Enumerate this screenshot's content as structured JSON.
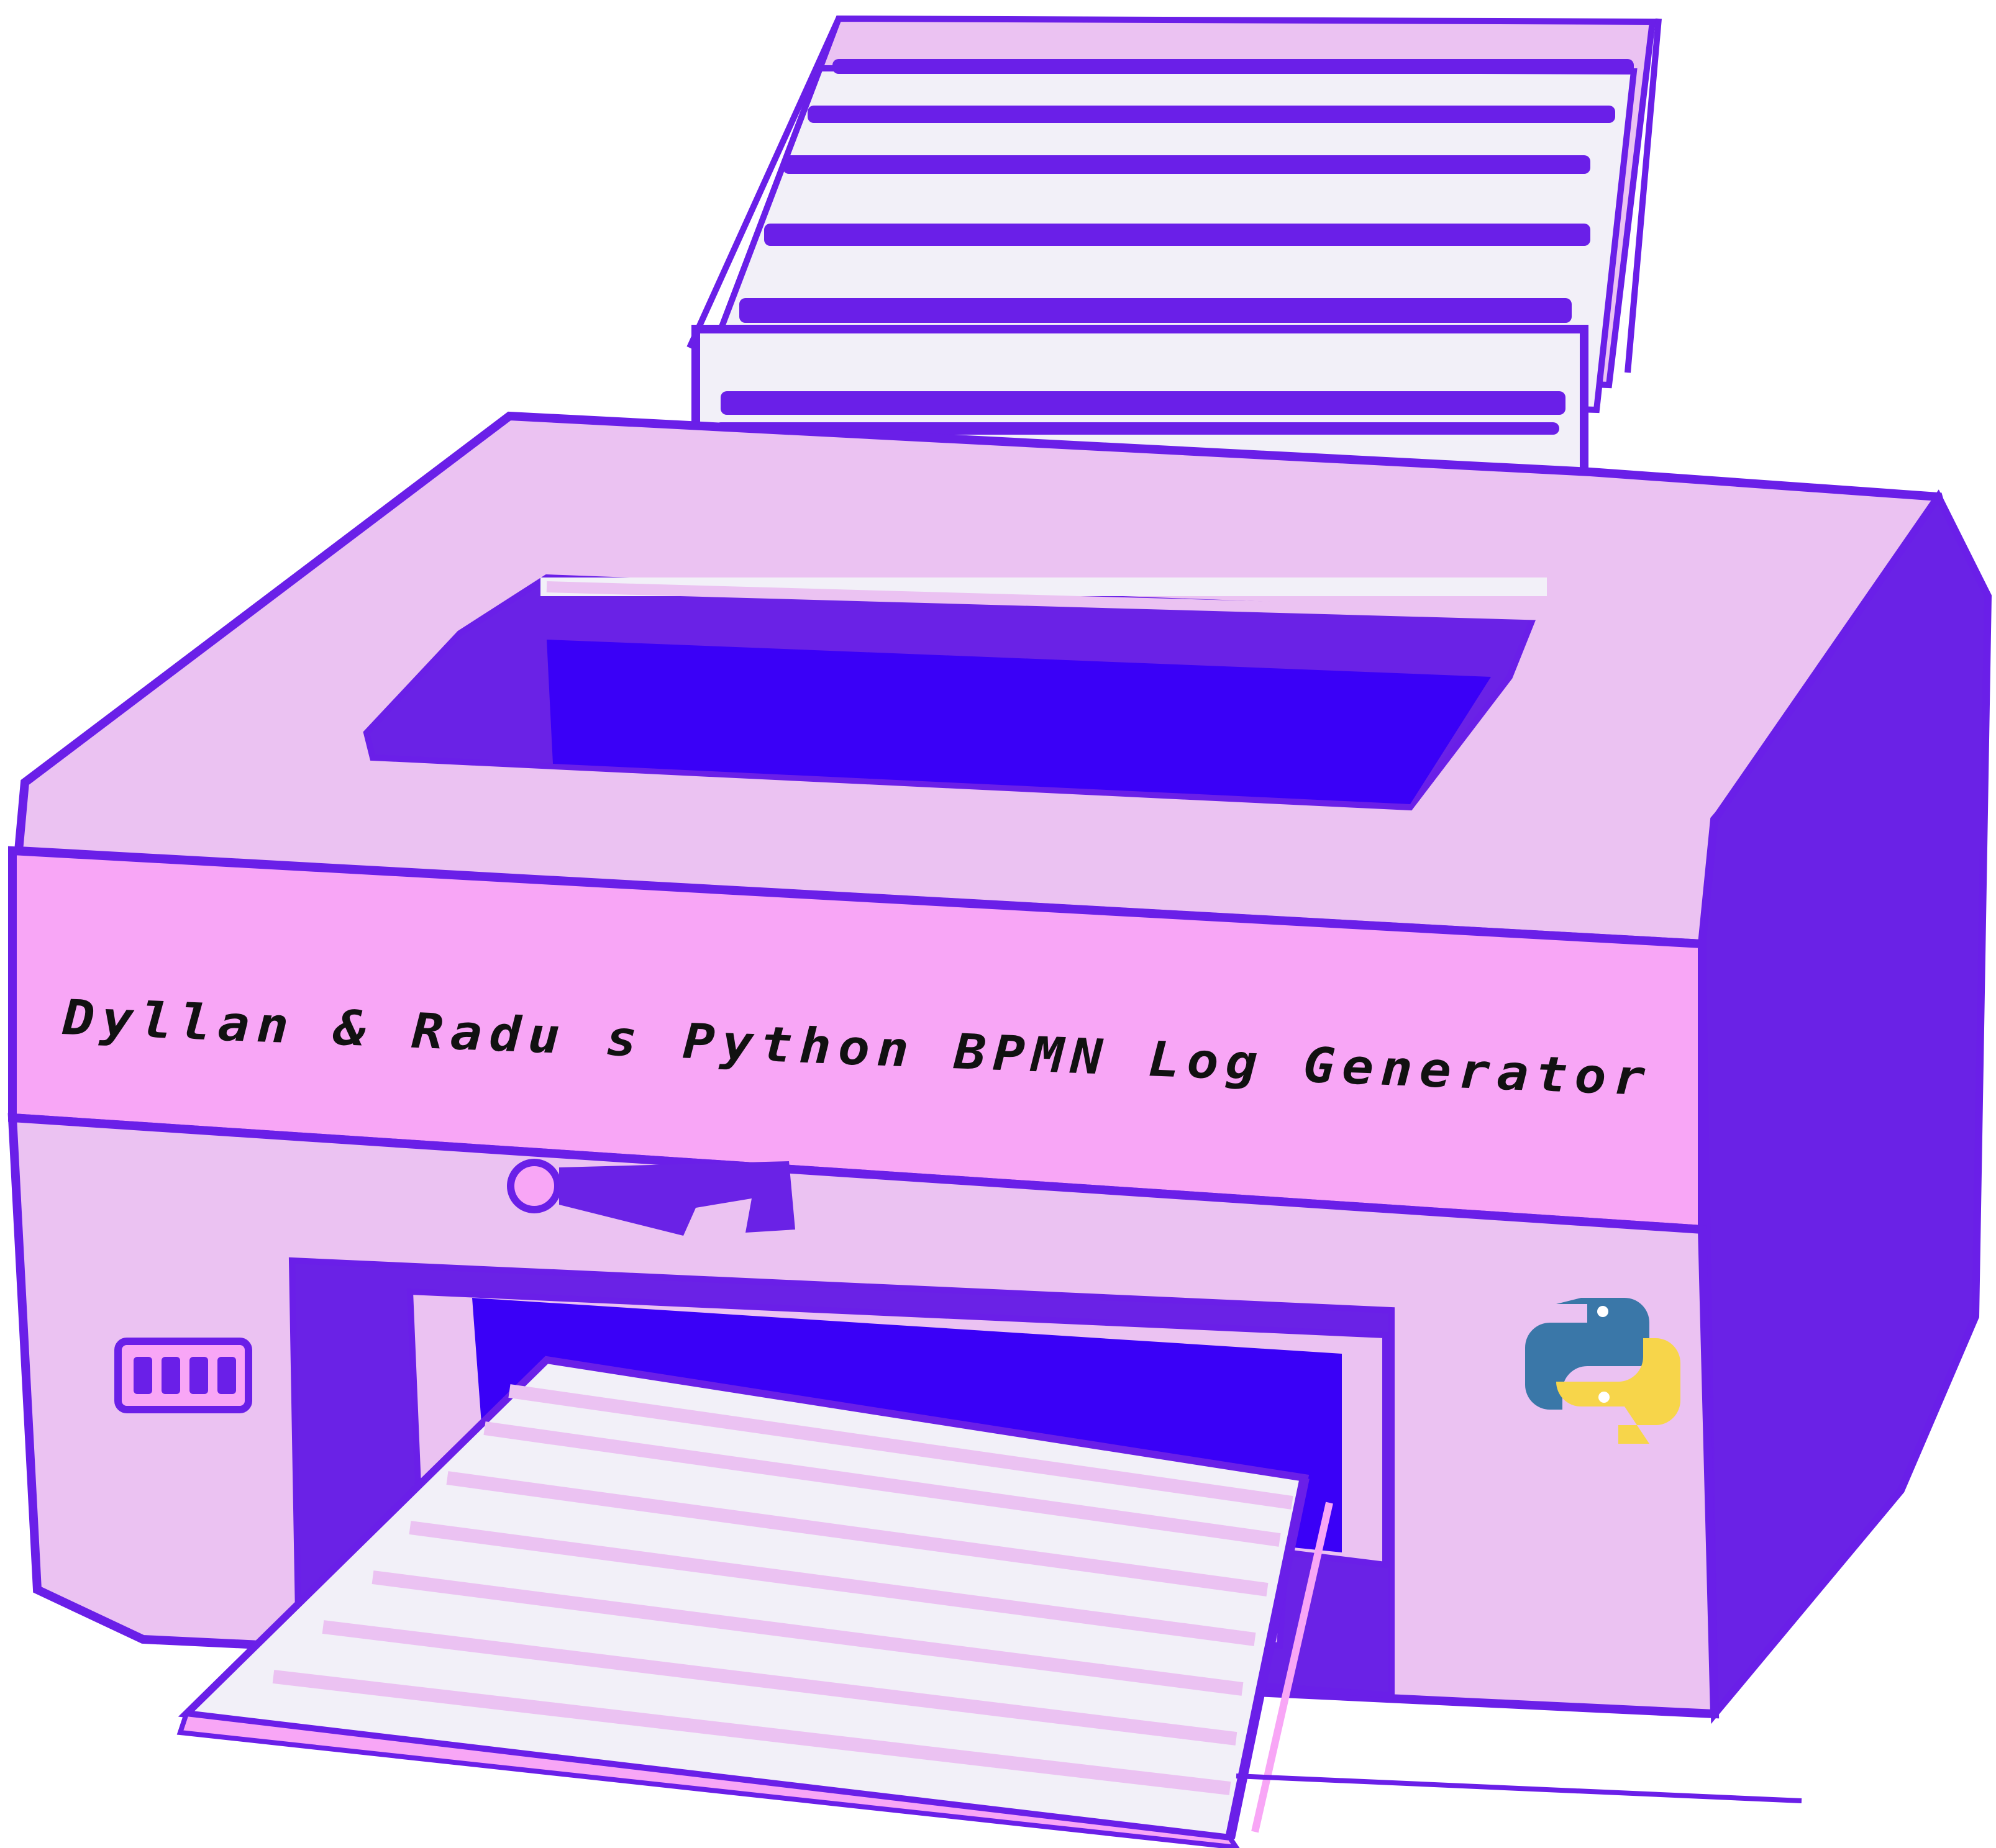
{
  "illustration": {
    "subject": "printer",
    "title": "Dyllan & Radu s Python BPMN Log Generator",
    "logo_icon": "python-logo-icon",
    "colors": {
      "outline": "#6a1fe8",
      "body_light": "#ebc2f2",
      "front_panel": "#f8a6f6",
      "side": "#6a22e6",
      "slot": "#3a00f7",
      "paper": "#f2f0f8",
      "python_blue": "#3a77a8",
      "python_yellow": "#f7d54a"
    }
  }
}
